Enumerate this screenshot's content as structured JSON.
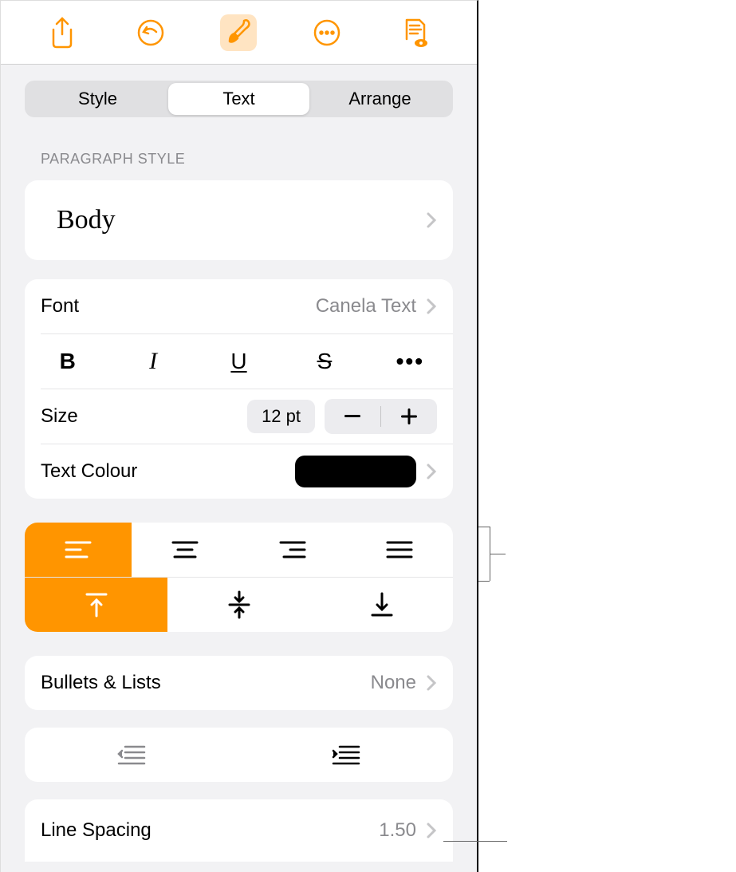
{
  "tabs": {
    "style": "Style",
    "text": "Text",
    "arrange": "Arrange"
  },
  "sections": {
    "paragraph_style_header": "PARAGRAPH STYLE",
    "paragraph_style_value": "Body"
  },
  "font": {
    "label": "Font",
    "value": "Canela Text"
  },
  "styles": {
    "bold": "B",
    "italic": "I",
    "underline": "U",
    "strike": "S",
    "more": "•••"
  },
  "size": {
    "label": "Size",
    "value": "12 pt"
  },
  "text_colour": {
    "label": "Text Colour",
    "value_hex": "#000000"
  },
  "bullets": {
    "label": "Bullets & Lists",
    "value": "None"
  },
  "line_spacing": {
    "label": "Line Spacing",
    "value": "1.50"
  }
}
